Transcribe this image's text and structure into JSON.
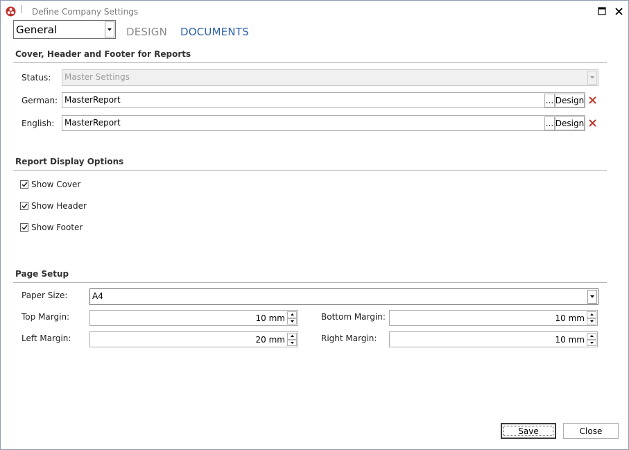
{
  "window": {
    "title": "Define Company Settings"
  },
  "top": {
    "combo_value": "General",
    "nav_design": "DESIGN",
    "nav_documents": "DOCUMENTS"
  },
  "cover": {
    "heading": "Cover, Header and Footer for Reports",
    "status_label": "Status:",
    "status_value": "Master Settings",
    "german_label": "German:",
    "german_value": "MasterReport",
    "english_label": "English:",
    "english_value": "MasterReport",
    "browse_label": "...",
    "design_label": "Design"
  },
  "display": {
    "heading": "Report Display Options",
    "options": [
      {
        "label": "Show Cover",
        "checked": true
      },
      {
        "label": "Show Header",
        "checked": true
      },
      {
        "label": "Show Footer",
        "checked": true
      }
    ]
  },
  "page_setup": {
    "heading": "Page Setup",
    "paper_size_label": "Paper Size:",
    "paper_size_value": "A4",
    "top_margin_label": "Top Margin:",
    "top_margin_value": "10 mm",
    "bottom_margin_label": "Bottom Margin:",
    "bottom_margin_value": "10 mm",
    "left_margin_label": "Left Margin:",
    "left_margin_value": "20 mm",
    "right_margin_label": "Right Margin:",
    "right_margin_value": "10 mm"
  },
  "buttons": {
    "save": "Save",
    "close": "Close"
  },
  "colors": {
    "accent": "#2a5fa8",
    "delete": "#c0392b",
    "app_icon": "#c0302c"
  }
}
